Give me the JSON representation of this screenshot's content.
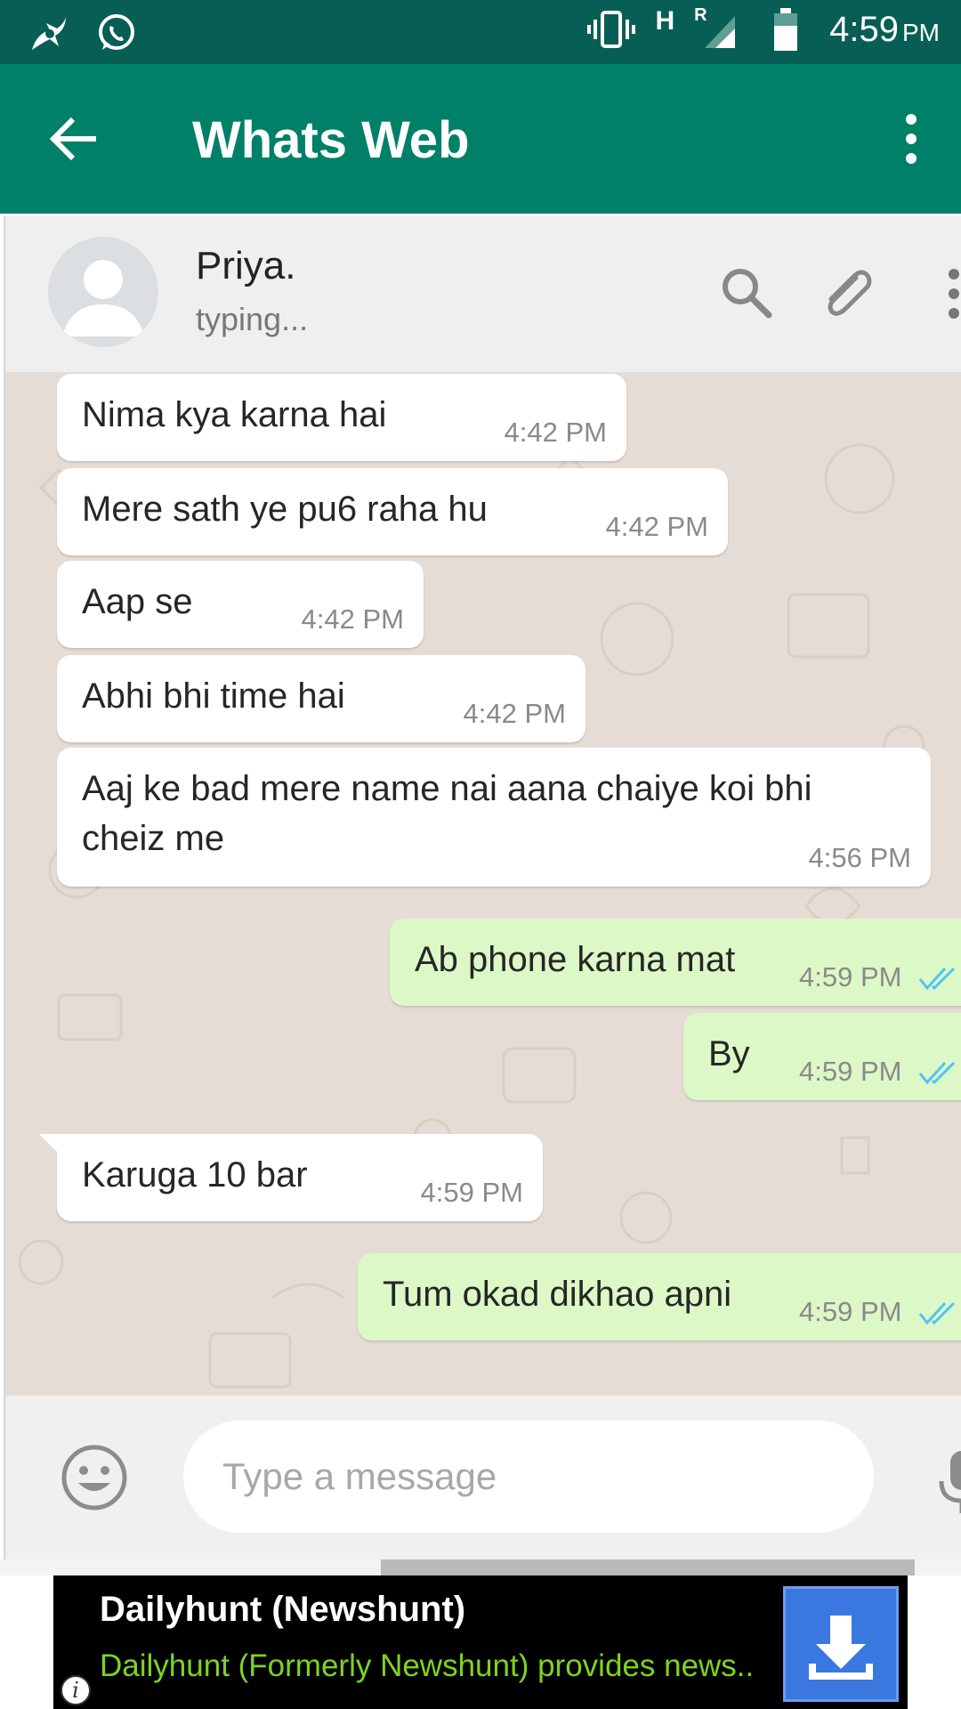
{
  "status_bar": {
    "time": "4:59",
    "ampm": "PM",
    "network": "H",
    "roaming": "R"
  },
  "app_bar": {
    "title": "Whats Web"
  },
  "contact": {
    "name": "Priya.",
    "status": "typing..."
  },
  "messages": [
    {
      "direction": "in",
      "text": "Nima kya karna hai",
      "time": "4:42 PM"
    },
    {
      "direction": "in",
      "text": "Mere sath ye pu6 raha hu",
      "time": "4:42 PM"
    },
    {
      "direction": "in",
      "text": "Aap se",
      "time": "4:42 PM"
    },
    {
      "direction": "in",
      "text": "Abhi bhi time hai",
      "time": "4:42 PM"
    },
    {
      "direction": "in",
      "text": "Aaj ke bad mere name nai aana chaiye koi bhi cheiz me",
      "time": "4:56 PM"
    },
    {
      "direction": "out",
      "text": "Ab phone karna mat",
      "time": "4:59 PM",
      "read": true
    },
    {
      "direction": "out",
      "text": "By",
      "time": "4:59 PM",
      "read": true
    },
    {
      "direction": "in",
      "text": "Karuga 10 bar",
      "time": "4:59 PM"
    },
    {
      "direction": "out",
      "text": "Tum okad dikhao apni",
      "time": "4:59 PM",
      "read": true
    }
  ],
  "composer": {
    "placeholder": "Type a message"
  },
  "ad": {
    "title": "Dailyhunt (Newshunt)",
    "description": "Dailyhunt (Formerly Newshunt) provides news..",
    "info": "i"
  },
  "colors": {
    "status_bar": "#075E54",
    "app_bar": "#008069",
    "incoming_bubble": "#ffffff",
    "outgoing_bubble": "#dcf8c6",
    "read_ticks": "#4fc3f7",
    "ad_description": "#7ed321",
    "ad_button": "#3a78e0"
  },
  "icons": {
    "status_left": [
      "avast-icon",
      "whatsapp-icon"
    ],
    "status_right": [
      "vibrate-icon",
      "signal-icon",
      "battery-icon"
    ],
    "header": [
      "back-arrow-icon",
      "overflow-menu-icon",
      "search-icon",
      "attach-icon",
      "more-icon"
    ],
    "composer": [
      "emoji-icon",
      "mic-icon"
    ],
    "ad": [
      "download-icon",
      "info-icon"
    ]
  }
}
